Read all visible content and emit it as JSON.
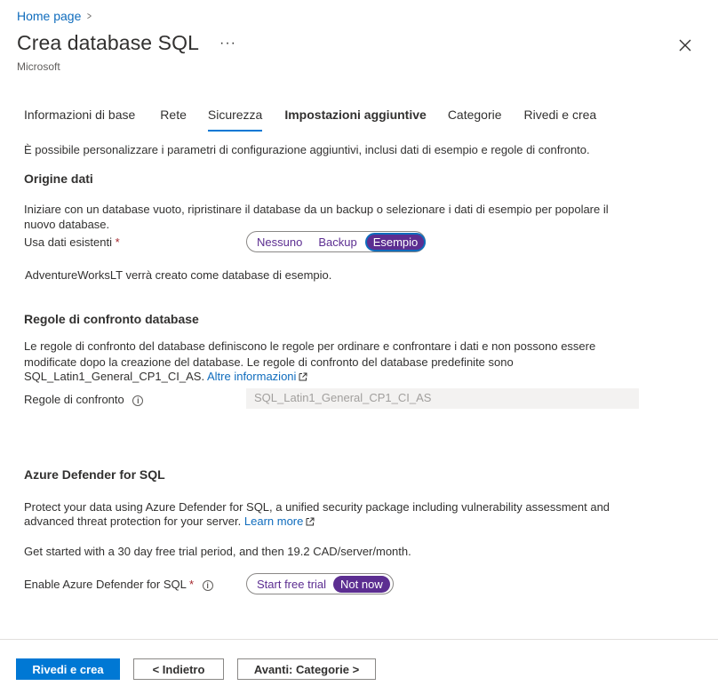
{
  "breadcrumb": {
    "home": "Home page"
  },
  "header": {
    "title": "Crea database SQL",
    "more": "···",
    "subtitle": "Microsoft"
  },
  "tabs": [
    {
      "label": "Informazioni di base"
    },
    {
      "label": "Rete"
    },
    {
      "label": "Sicurezza"
    },
    {
      "label": "Impostazioni aggiuntive"
    },
    {
      "label": "Categorie"
    },
    {
      "label": "Rivedi e crea"
    }
  ],
  "intro": "È possibile personalizzare i parametri di configurazione aggiuntivi, inclusi dati di esempio e regole di confronto.",
  "data_source": {
    "heading": "Origine dati",
    "desc_line1": "Iniziare con un database vuoto, ripristinare il database da un backup o selezionare i dati di esempio per popolare il",
    "desc_line2": "nuovo database.",
    "field_label": "Usa dati esistenti",
    "required_mark": "*",
    "options": [
      "Nessuno",
      "Backup",
      "Esempio"
    ],
    "selected": "Esempio",
    "note": "AdventureWorksLT verrà creato come database di esempio."
  },
  "collation": {
    "heading": "Regole di confronto database",
    "desc_line1": "Le regole di confronto del database definiscono le regole per ordinare e confrontare i dati e non possono essere",
    "desc_line2": "modificate dopo la creazione del database. Le regole di confronto del database predefinite sono",
    "desc_line3": "SQL_Latin1_General_CP1_CI_AS.",
    "link": "Altre informazioni",
    "field_label": "Regole di confronto",
    "value": "SQL_Latin1_General_CP1_CI_AS"
  },
  "defender": {
    "heading": "Azure Defender for SQL",
    "desc_line1": "Protect your data using Azure Defender for SQL, a unified security package including vulnerability assessment and",
    "desc_line2": "advanced threat protection for your server.",
    "link": "Learn more",
    "trial_text": "Get started with a 30 day free trial period, and then 19.2 CAD/server/month.",
    "field_label": "Enable Azure Defender for SQL",
    "required_mark": "*",
    "options": [
      "Start free trial",
      "Not now"
    ],
    "selected": "Not now"
  },
  "footer": {
    "review_create": "Rivedi e crea",
    "back": "< Indietro",
    "next": "Avanti: Categorie >"
  },
  "colors": {
    "accent": "#0078d4",
    "toggle_selected": "#5c2e91",
    "link": "#0f6cbd",
    "required": "#a4262c"
  }
}
